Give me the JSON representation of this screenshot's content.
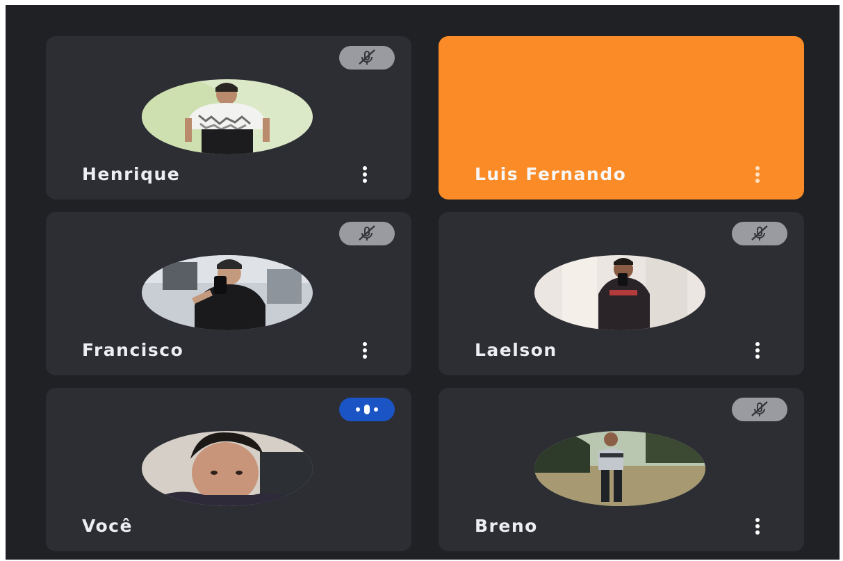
{
  "participants": [
    {
      "name": "Henrique",
      "status": "muted"
    },
    {
      "name": "Luis Fernando",
      "status": "speaking"
    },
    {
      "name": "Francisco",
      "status": "muted"
    },
    {
      "name": "Laelson",
      "status": "muted"
    },
    {
      "name": "Você",
      "status": "audio-active"
    },
    {
      "name": "Breno",
      "status": "muted"
    }
  ],
  "icons": {
    "muted": "mic-off-icon",
    "audio": "audio-level-icon",
    "menu": "more-vert-icon"
  },
  "colors": {
    "background": "#1f2125",
    "tile": "#2c2e33",
    "speaking": "#fa8b27",
    "audio_active": "#1b54c4",
    "mute_badge": "#9a9ba0"
  }
}
